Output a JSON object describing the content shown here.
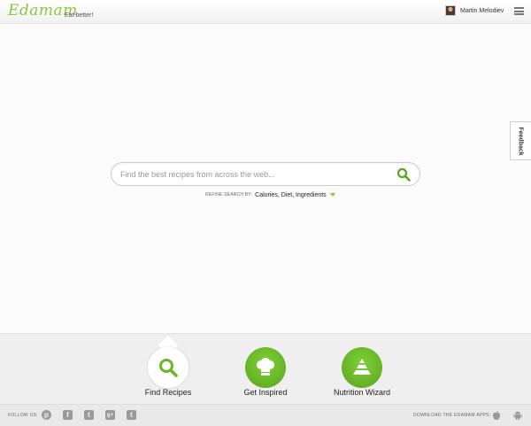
{
  "header": {
    "logo": "Edamam",
    "tagline": "Eat better!",
    "username": "Martin Melodiev"
  },
  "feedback": {
    "label": "Feedback"
  },
  "search": {
    "placeholder": "Find the best recipes from across the web...",
    "refine_label": "REFINE SEARCH BY:",
    "refine_options": "Calories, Diet, Ingredients"
  },
  "features": [
    {
      "label": "Find Recipes",
      "icon": "search-icon"
    },
    {
      "label": "Get Inspired",
      "icon": "chef-hat-icon"
    },
    {
      "label": "Nutrition Wizard",
      "icon": "pyramid-icon"
    }
  ],
  "footer": {
    "follow_label": "FOLLOW US:",
    "social": [
      {
        "name": "pinterest",
        "glyph": "p"
      },
      {
        "name": "facebook",
        "glyph": "f"
      },
      {
        "name": "twitter",
        "glyph": "t"
      },
      {
        "name": "google-plus",
        "glyph": "g+"
      },
      {
        "name": "tumblr",
        "glyph": "t"
      }
    ],
    "apps_label": "DOWNLOAD THE EDAMAM APPS:"
  },
  "colors": {
    "brand_green": "#8cc63f",
    "icon_green": "#5aa51c",
    "background": "#fbfbfb"
  }
}
